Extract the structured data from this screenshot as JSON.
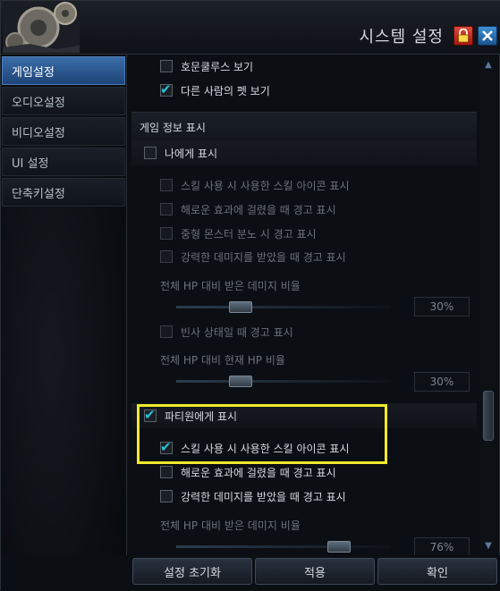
{
  "window": {
    "title": "시스템 설정"
  },
  "sidebar": {
    "items": [
      {
        "label": "게임설정",
        "active": true
      },
      {
        "label": "오디오설정",
        "active": false
      },
      {
        "label": "비디오설정",
        "active": false
      },
      {
        "label": "UI 설정",
        "active": false
      },
      {
        "label": "단축키설정",
        "active": false
      }
    ]
  },
  "content": {
    "top_options": [
      {
        "label": "호문쿨루스 보기",
        "checked": false
      },
      {
        "label": "다른 사람의 펫 보기",
        "checked": true
      }
    ],
    "section_title": "게임 정보 표시",
    "self_group": {
      "label": "나에게 표시",
      "checked": false,
      "options": [
        {
          "label": "스킬 사용 시 사용한 스킬 아이콘 표시",
          "checked": false
        },
        {
          "label": "해로운 효과에 걸렸을 때 경고 표시",
          "checked": false
        },
        {
          "label": "중형 몬스터 분노 시 경고 표시",
          "checked": false
        },
        {
          "label": "강력한 데미지를 받았을 때 경고 표시",
          "checked": false
        }
      ],
      "damage_slider": {
        "caption": "전체 HP 대비 받은 데미지 비율",
        "value_label": "30%",
        "value": 0.3
      },
      "dying_option": {
        "label": "빈사 상태일 때 경고 표시",
        "checked": false
      },
      "hp_slider": {
        "caption": "전체 HP 대비 현재 HP 비율",
        "value_label": "30%",
        "value": 0.3
      }
    },
    "party_group": {
      "label": "파티원에게 표시",
      "checked": true,
      "options": [
        {
          "label": "스킬 사용 시 사용한 스킬 아이콘 표시",
          "checked": true
        },
        {
          "label": "해로운 효과에 걸렸을 때 경고 표시",
          "checked": false
        },
        {
          "label": "강력한 데미지를 받았을 때 경고 표시",
          "checked": false
        }
      ],
      "damage_slider": {
        "caption": "전체 HP 대비 받은 데미지 비율",
        "value_label": "76%",
        "value": 0.76
      }
    }
  },
  "footer": {
    "reset_label": "설정 초기화",
    "apply_label": "적용",
    "ok_label": "확인"
  },
  "colors": {
    "accent": "#3c6ca8",
    "checkmark": "#27c2d8",
    "highlight": "#f2e92a",
    "lock": "#c4281c",
    "close": "#2c73b8"
  }
}
